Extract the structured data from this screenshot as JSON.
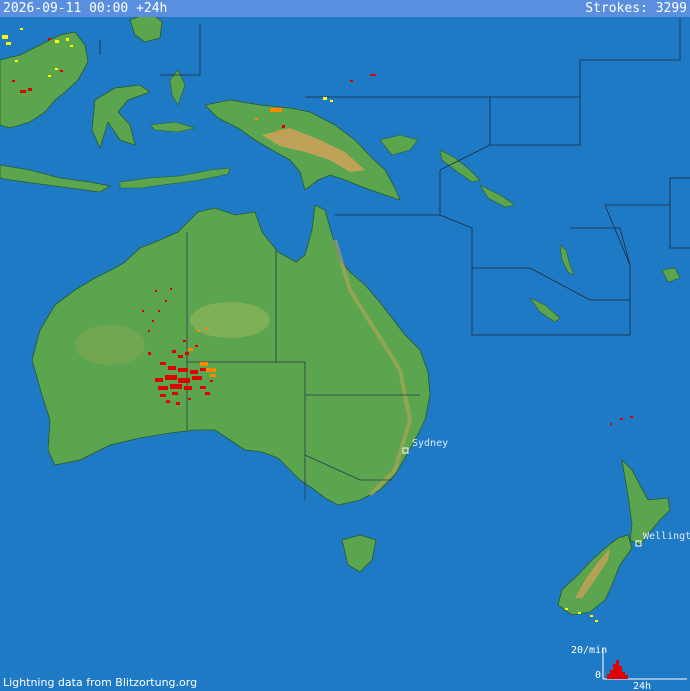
{
  "header": {
    "datetime": "2026-09-11 00:00 +24h",
    "strokes_label": "Strokes: 3299"
  },
  "footer": {
    "credit": "Lightning data from Blitzortung.org"
  },
  "cities": [
    {
      "name": "Sydney"
    },
    {
      "name": "Wellington"
    }
  ],
  "histogram": {
    "rate_label": "20/min",
    "zero_label": "0",
    "range_label": "24h",
    "bar_color": "#e00000"
  },
  "colors": {
    "ocean": "#1f7ac6",
    "land": "#5aa54e",
    "highland": "#d8a05a",
    "recent_strike": "#ff0000",
    "older_strike": "#ffff00",
    "mid_strike": "#ff8800"
  }
}
